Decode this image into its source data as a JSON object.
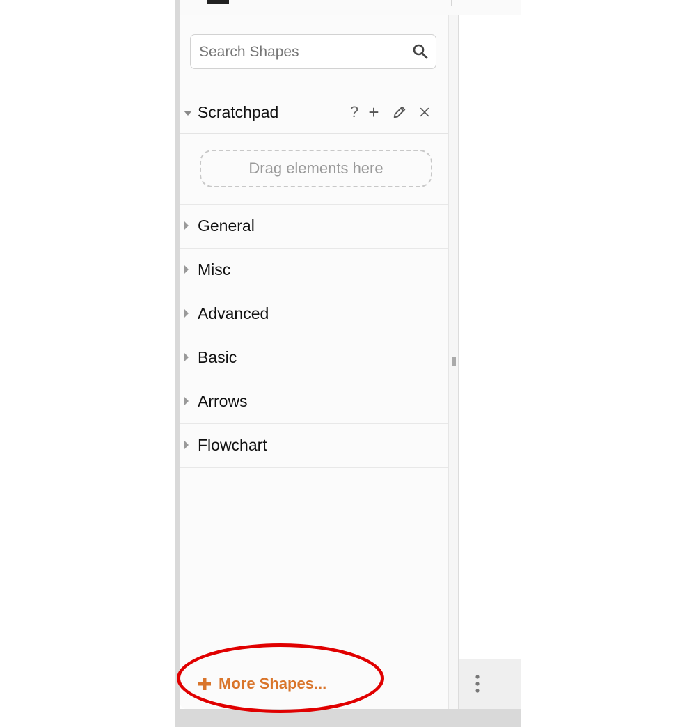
{
  "search": {
    "placeholder": "Search Shapes"
  },
  "scratchpad": {
    "title": "Scratchpad",
    "help_icon": "?",
    "add_icon": "+",
    "drop_zone_text": "Drag elements here"
  },
  "libraries": [
    {
      "label": "General"
    },
    {
      "label": "Misc"
    },
    {
      "label": "Advanced"
    },
    {
      "label": "Basic"
    },
    {
      "label": "Arrows"
    },
    {
      "label": "Flowchart"
    }
  ],
  "footer": {
    "more_shapes_label": "More Shapes..."
  },
  "icons": {
    "search": "search-icon",
    "edit": "pencil-icon",
    "close": "close-icon",
    "collapse": "triangle-down-icon",
    "expand": "triangle-right-icon",
    "plus": "plus-icon",
    "grip": "splitter-grip-icon",
    "kebab": "vertical-dots-icon"
  },
  "colors": {
    "accent_orange": "#d9752b",
    "annotation_red": "#e00000"
  }
}
